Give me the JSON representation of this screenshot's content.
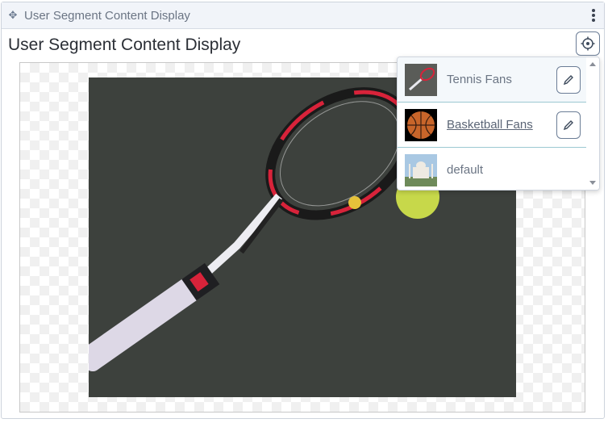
{
  "portlet": {
    "topbar_title": "User Segment Content Display",
    "page_title": "User Segment Content Display"
  },
  "image": {
    "subject": "tennis racket with tennis ball"
  },
  "segments": [
    {
      "label": "Tennis Fans",
      "thumbnail": "tennis-racket",
      "editable": true,
      "underlined": false
    },
    {
      "label": "Basketball Fans",
      "thumbnail": "basketball",
      "editable": true,
      "underlined": true
    },
    {
      "label": "default",
      "thumbnail": "taj-mahal",
      "editable": false,
      "underlined": false
    }
  ],
  "icons": {
    "drag": "move-icon",
    "menu": "kebab-menu-icon",
    "target": "target-icon",
    "edit": "pencil-icon"
  },
  "colors": {
    "topbar_bg": "#f1f4f9",
    "divider": "#9cc9d2",
    "button_border": "#6b7d96",
    "image_bg": "#3d413d"
  }
}
